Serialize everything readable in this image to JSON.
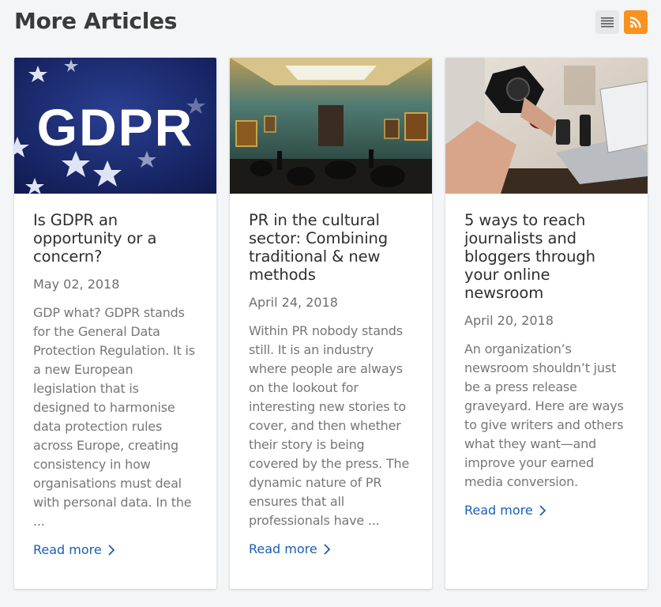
{
  "header": {
    "title": "More Articles",
    "list_view_icon": "list-view-icon",
    "rss_icon": "rss-feed-icon"
  },
  "colors": {
    "rss": "#f7931e",
    "link": "#1a5fb4",
    "gdpr_blue": "#1b2a6b"
  },
  "articles": [
    {
      "image": "gdpr-flag-image",
      "image_text": "GDPR",
      "title": "Is GDPR an opportunity or a concern?",
      "date": "May 02, 2018",
      "excerpt": "GDP what? GDPR stands for the General Data Protection Regulation. It is a new European legislation that is designed to harmonise data protection rules across Europe, creating consistency in how organisations must deal with personal data. In the ...",
      "read_more": "Read more"
    },
    {
      "image": "museum-gallery-image",
      "title": "PR in the cultural sector: Combining traditional & new methods",
      "date": "April 24, 2018",
      "excerpt": "Within PR nobody stands still. It is an industry where people are always on the lookout for interesting new stories to cover, and then whether their story is being covered by the press. The dynamic nature of PR ensures that all professionals have ...",
      "read_more": "Read more"
    },
    {
      "image": "camera-desk-image",
      "title": "5 ways to reach journalists and bloggers through your online newsroom",
      "date": "April 20, 2018",
      "excerpt": "An organization’s newsroom shouldn’t just be a press release graveyard. Here are ways to give writers and others what they want—and improve your earned media conversion.",
      "read_more": "Read more"
    }
  ]
}
